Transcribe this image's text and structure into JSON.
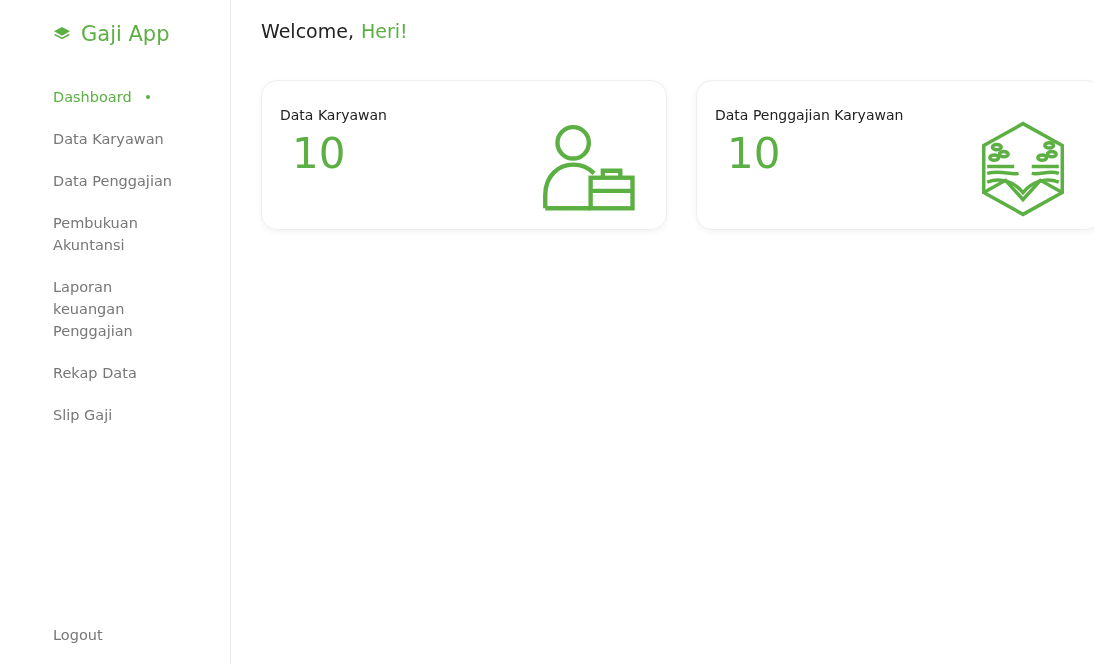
{
  "brand": {
    "name": "Gaji App"
  },
  "nav": [
    {
      "label": "Dashboard",
      "selected": true
    },
    {
      "label": "Data Karyawan",
      "selected": false
    },
    {
      "label": "Data Penggajian",
      "selected": false
    },
    {
      "label": "Pembukuan Akuntansi",
      "selected": false
    },
    {
      "label": "Laporan keuangan Penggajian",
      "selected": false
    },
    {
      "label": "Rekap Data",
      "selected": false
    },
    {
      "label": "Slip Gaji",
      "selected": false
    }
  ],
  "logout": "Logout",
  "header": {
    "greeting": "Welcome,",
    "name": "Heri!"
  },
  "cards": [
    {
      "title": "Data Karyawan",
      "value": "10",
      "kind": "employee"
    },
    {
      "title": "Data Penggajian Karyawan",
      "value": "10",
      "kind": "emblem"
    }
  ]
}
